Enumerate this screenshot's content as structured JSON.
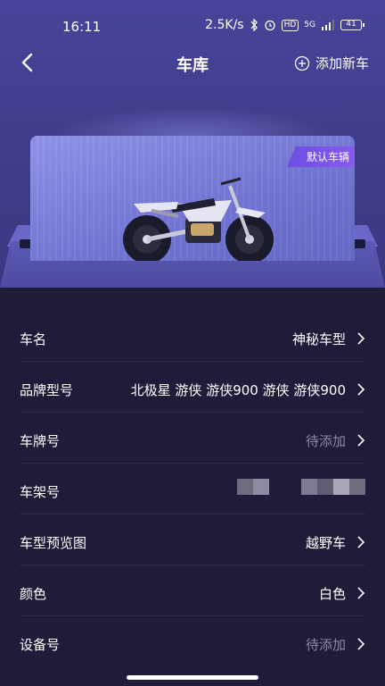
{
  "status_bar": {
    "time": "16:11",
    "speed": "2.5K/s",
    "hd_label": "HD",
    "network": "5G",
    "battery": "41"
  },
  "nav": {
    "title": "车库",
    "add_label": "添加新车"
  },
  "garage": {
    "badge": "默认车辆",
    "vehicle_icon": "dirt-bike"
  },
  "fields": [
    {
      "label": "车名",
      "value": "神秘车型",
      "pending": false
    },
    {
      "label": "品牌型号",
      "value": "北极星 游侠 游侠900 游侠 游侠900",
      "pending": false
    },
    {
      "label": "车牌号",
      "value": "待添加",
      "pending": true
    },
    {
      "label": "车架号",
      "value": "",
      "masked": true
    },
    {
      "label": "车型预览图",
      "value": "越野车",
      "pending": false
    },
    {
      "label": "颜色",
      "value": "白色",
      "pending": false
    },
    {
      "label": "设备号",
      "value": "待添加",
      "pending": true
    }
  ],
  "colors": {
    "background": "#1f1c3a",
    "header": "#48459a",
    "card": "#7f82de",
    "badge": "#7a55ea",
    "pending_text": "#8b89a6"
  }
}
